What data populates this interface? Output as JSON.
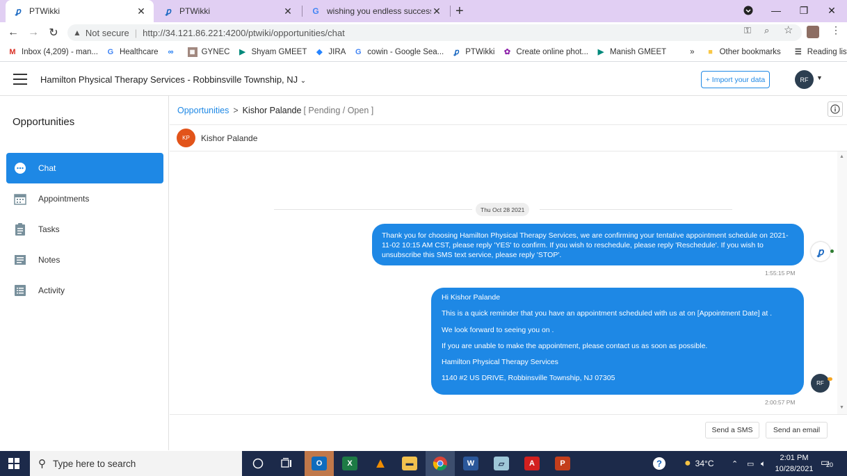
{
  "browser": {
    "tabs": [
      {
        "title": "PTWikki",
        "icon": "ptwikki-icon",
        "active": true
      },
      {
        "title": "PTWikki",
        "icon": "ptwikki-icon",
        "active": false
      },
      {
        "title": "wishing you endless success - Go",
        "icon": "google-icon",
        "active": false
      }
    ],
    "new_tab": "+",
    "not_secure": "Not secure",
    "url": "http://34.121.86.221:4200/ptwiki/opportunities/chat",
    "bookmarks": [
      {
        "label": "Inbox (4,209) - man...",
        "icon": "gmail-icon"
      },
      {
        "label": "Healthcare",
        "icon": "google-icon"
      },
      {
        "label": "",
        "icon": "meta-icon"
      },
      {
        "label": "GYNEC",
        "icon": "gynec-icon"
      },
      {
        "label": "Shyam GMEET",
        "icon": "meet-icon"
      },
      {
        "label": "JIRA",
        "icon": "jira-icon"
      },
      {
        "label": "cowin - Google Sea...",
        "icon": "google-icon"
      },
      {
        "label": "PTWikki",
        "icon": "ptwikki-icon"
      },
      {
        "label": "Create online phot...",
        "icon": "photo-icon"
      },
      {
        "label": "Manish GMEET",
        "icon": "meet-icon"
      }
    ],
    "more_bookmarks": "»",
    "other_bookmarks": "Other bookmarks",
    "reading_list": "Reading list"
  },
  "header": {
    "practice": "Hamilton Physical Therapy Services - Robbinsville Township, NJ",
    "import_button": "+ Import your data",
    "user_initials": "RF"
  },
  "sidebar": {
    "title": "Opportunities",
    "items": [
      {
        "label": "Chat",
        "icon": "chat-icon",
        "active": true
      },
      {
        "label": "Appointments",
        "icon": "calendar-icon",
        "active": false
      },
      {
        "label": "Tasks",
        "icon": "clipboard-icon",
        "active": false
      },
      {
        "label": "Notes",
        "icon": "notes-icon",
        "active": false
      },
      {
        "label": "Activity",
        "icon": "list-icon",
        "active": false
      }
    ]
  },
  "breadcrumb": {
    "root": "Opportunities",
    "separator": ">",
    "current": "Kishor Palande",
    "status": "[ Pending / Open ]"
  },
  "contact": {
    "initials": "KP",
    "name": "Kishor Palande"
  },
  "chat": {
    "date_divider": "Thu Oct 28 2021",
    "messages": [
      {
        "text": "Thank you for choosing Hamilton Physical Therapy Services, we are confirming your tentative appointment schedule on 2021-11-02 10:15 AM CST, please reply 'YES' to confirm. If you wish to reschedule, please reply 'Reschedule'. If you wish to unsubscribe this SMS text service, please reply 'STOP'.",
        "time": "1:55:15 PM"
      },
      {
        "lines": [
          "Hi Kishor Palande",
          "This is a quick reminder that you have an appointment scheduled with us at on [Appointment Date] at .",
          "We look forward to seeing you on .",
          "If you are unable to make the appointment, please contact us as soon as possible.",
          "Hamilton Physical Therapy Services",
          "1140 #2 US DRIVE, Robbinsville Township, NJ 07305"
        ],
        "time": "2:00:57 PM",
        "sender_initials": "RF"
      }
    ]
  },
  "footer": {
    "send_sms": "Send a SMS",
    "send_email": "Send an email"
  },
  "taskbar": {
    "search_placeholder": "Type here to search",
    "weather": "34°C",
    "time": "2:01 PM",
    "date": "10/28/2021",
    "notifications": "20",
    "colors": {
      "outlook": "#0f6cbd",
      "excel": "#1d7a45",
      "word": "#2b579a",
      "powerpoint": "#c43e1c",
      "acrobat": "#d3201f"
    }
  },
  "colors": {
    "accent": "#1e88e5",
    "tabstrip": "#e1cff3",
    "contact_avatar": "#e2541a"
  }
}
